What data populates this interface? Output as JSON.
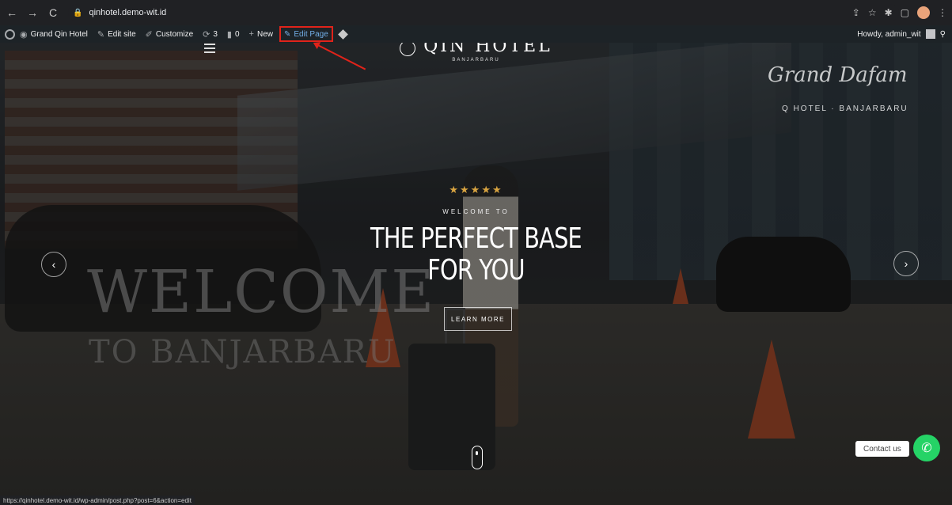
{
  "browser": {
    "url": "qinhotel.demo-wit.id",
    "status_url": "https://qinhotel.demo-wit.id/wp-admin/post.php?post=6&action=edit"
  },
  "admin_bar": {
    "site_name": "Grand Qin Hotel",
    "edit_site": "Edit site",
    "customize": "Customize",
    "updates_count": "3",
    "comments_count": "0",
    "new_label": "New",
    "edit_page": "Edit Page",
    "howdy": "Howdy, admin_wit"
  },
  "hero": {
    "hotel_name": "QIN HOTEL",
    "hotel_location": "BANJARBARU",
    "signature": "Grand Dafam",
    "sub_brand": "Q HOTEL · BANJARBARU",
    "stars": "★★★★★",
    "welcome_to": "WELCOME TO",
    "headline_line1": "THE PERFECT BASE",
    "headline_line2": "FOR YOU",
    "cta": "LEARN MORE",
    "bg_text_1": "WELCOME",
    "bg_text_2": "TO BANJARBARU",
    "prev": "‹",
    "next": "›"
  },
  "contact": {
    "label": "Contact us"
  },
  "colors": {
    "admin_bar": "#1d2327",
    "edit_highlight": "#e0231a",
    "whatsapp": "#25d366",
    "stars": "#d9a441"
  }
}
